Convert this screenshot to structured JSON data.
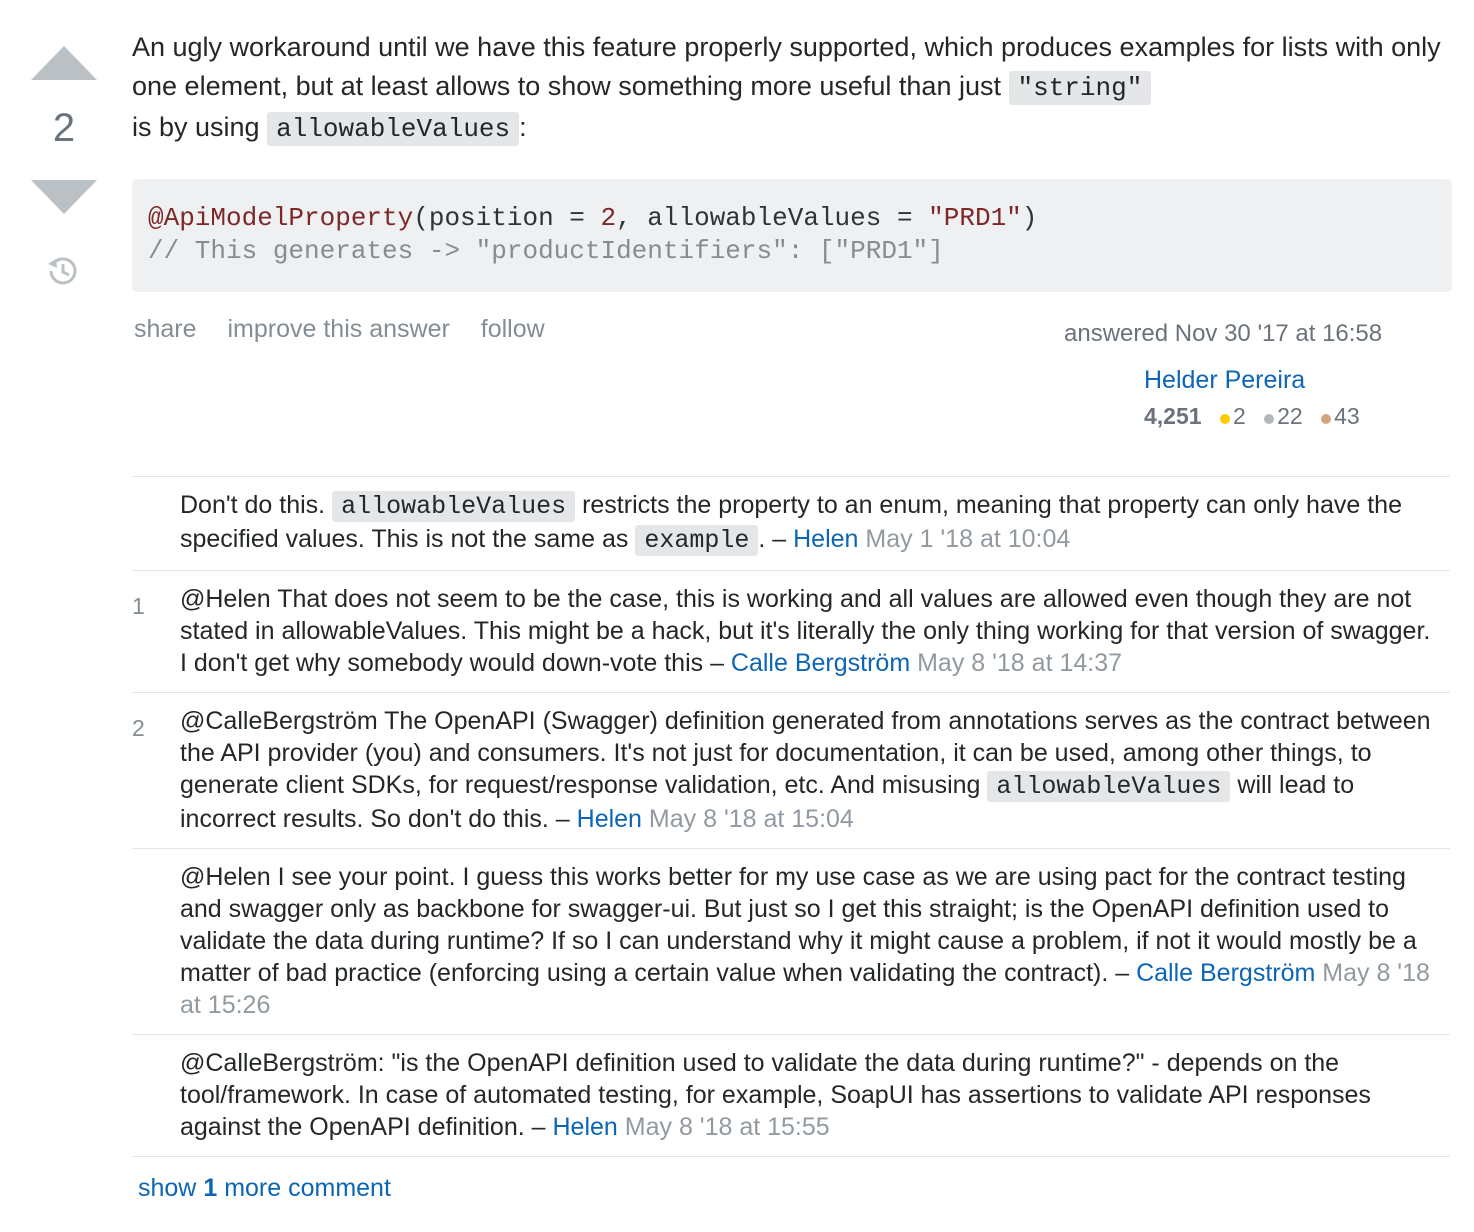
{
  "vote": {
    "count": "2"
  },
  "post": {
    "text_before": "An ugly workaround until we have this feature properly supported, which produces examples for lists with only one element, but at least allows to show something more useful than just",
    "code1": "\"string\"",
    "text_mid": "is by using",
    "code2": "allowableValues",
    "text_after": ":",
    "codeblock": {
      "ann": "@ApiModelProperty",
      "p1": "(position = ",
      "num": "2",
      "p2": ", allowableValues = ",
      "str": "\"PRD1\"",
      "p3": ")",
      "comment": "// This generates -> \"productIdentifiers\": [\"PRD1\"]"
    }
  },
  "menu": {
    "share": "share",
    "improve": "improve this answer",
    "follow": "follow"
  },
  "signature": {
    "action": "answered Nov 30 '17 at 16:58",
    "user": "Helder Pereira",
    "rep": "4,251",
    "gold": "2",
    "silver": "22",
    "bronze": "43",
    "colors": {
      "gold": "#ffcc01",
      "silver": "#b4b8bc",
      "bronze": "#d1a684"
    }
  },
  "comments": [
    {
      "score": "",
      "parts": [
        "Don't do this. ",
        "allowableValues",
        " restricts the property to an enum, meaning that property can only have the specified values. This is not the same as ",
        "example",
        ". – "
      ],
      "user": "Helen",
      "date": "May 1 '18 at 10:04"
    },
    {
      "score": "1",
      "text": "@Helen That does not seem to be the case, this is working and all values are allowed even though they are not stated in allowableValues. This might be a hack, but it's literally the only thing working for that version of swagger. I don't get why somebody would down-vote this – ",
      "user": "Calle Bergström",
      "date": "May 8 '18 at 14:37"
    },
    {
      "score": "2",
      "parts": [
        "@CalleBergström The OpenAPI (Swagger) definition generated from annotations serves as the contract between the API provider (you) and consumers. It's not just for documentation, it can be used, among other things, to generate client SDKs, for request/response validation, etc. And misusing ",
        "allowableValues",
        " will lead to incorrect results. So don't do this. – "
      ],
      "user": "Helen",
      "date": "May 8 '18 at 15:04"
    },
    {
      "score": "",
      "text": "@Helen I see your point. I guess this works better for my use case as we are using pact for the contract testing and swagger only as backbone for swagger-ui. But just so I get this straight; is the OpenAPI definition used to validate the data during runtime? If so I can understand why it might cause a problem, if not it would mostly be a matter of bad practice (enforcing using a certain value when validating the contract). – ",
      "user": "Calle Bergström",
      "date": "May 8 '18 at 15:26"
    },
    {
      "score": "",
      "text": "@CalleBergström: \"is the OpenAPI definition used to validate the data during runtime?\" - depends on the tool/framework. In case of automated testing, for example, SoapUI has assertions to validate API responses against the OpenAPI definition. – ",
      "user": "Helen",
      "date": "May 8 '18 at 15:55"
    }
  ],
  "show_more": {
    "pre": "show",
    "count": "1",
    "post": "more comment"
  }
}
